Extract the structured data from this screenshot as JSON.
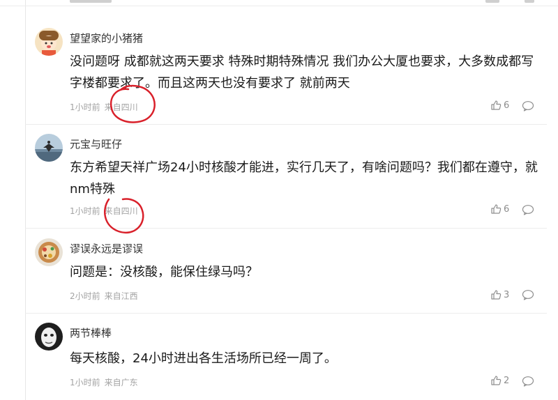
{
  "comments": [
    {
      "username": "望望家的小猪猪",
      "content": "没问题呀 成都就这两天要求 特殊时期特殊情况 我们办公大厦也要求，大多数成都写字楼都要求了。而且这两天也没有要求了 就前两天",
      "time": "1小时前",
      "location": "来自四川",
      "likes": "6"
    },
    {
      "username": "元宝与旺仔",
      "content": "东方希望天祥广场24小时核酸才能进，实行几天了，有啥问题吗？我们都在遵守，就nm特殊",
      "time": "1小时前",
      "location": "来自四川",
      "likes": "6"
    },
    {
      "username": "谬误永远是谬误",
      "content": "问题是：没核酸，能保住绿马吗？",
      "time": "2小时前",
      "location": "来自江西",
      "likes": "3"
    },
    {
      "username": "两节棒棒",
      "content": "每天核酸，24小时进出各生活场所已经一周了。",
      "time": "1小时前",
      "location": "来自广东",
      "likes": "2"
    }
  ],
  "icons": {
    "like": "thumbs-up-icon",
    "reply": "comment-bubble-icon"
  },
  "colors": {
    "annotation": "#d9202a",
    "meta_text": "#a3a3a3",
    "divider": "#ececec"
  }
}
